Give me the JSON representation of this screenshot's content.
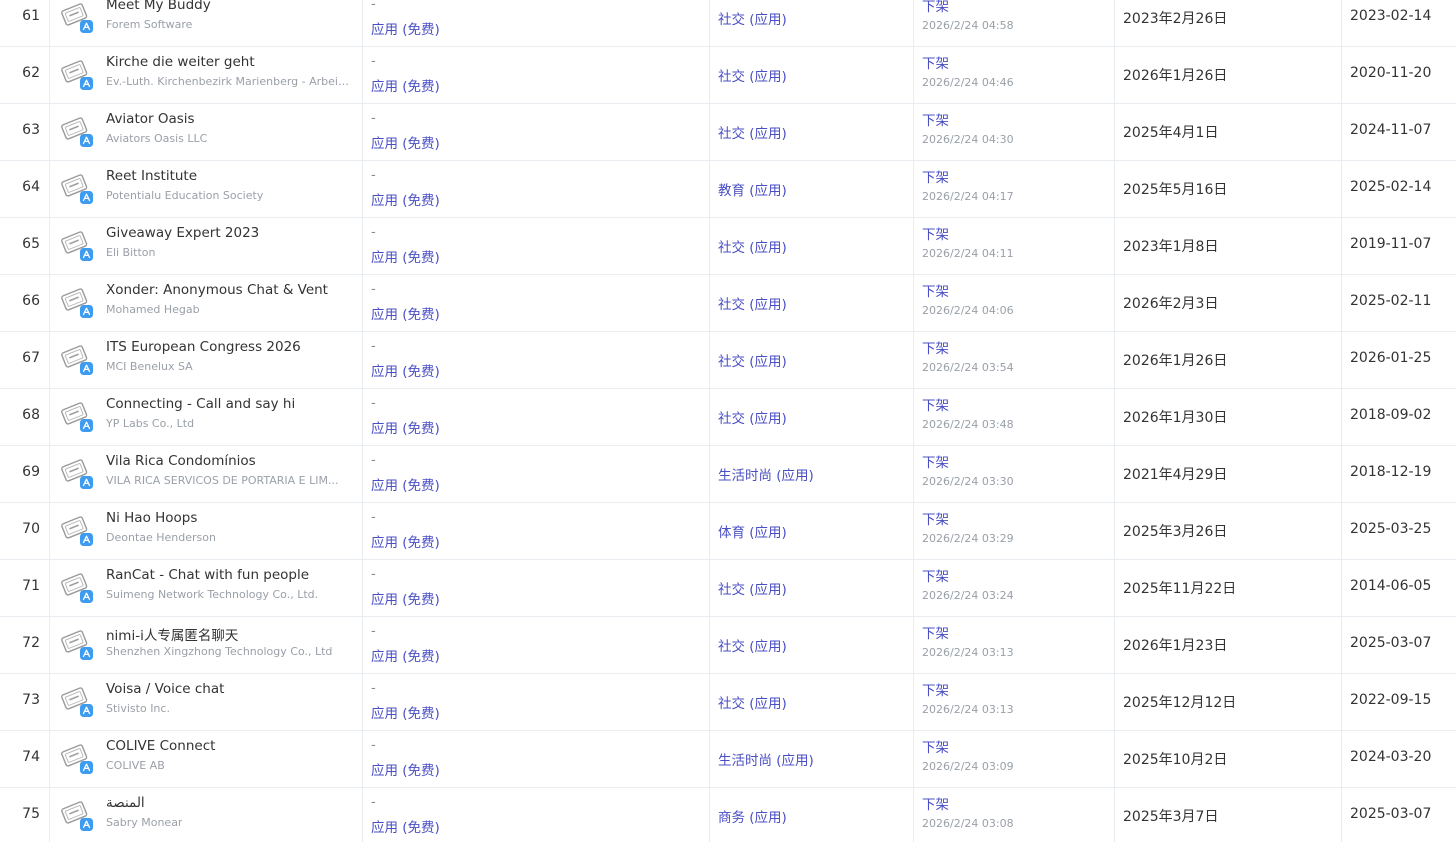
{
  "rows": [
    {
      "index": "61",
      "name": "Meet My Buddy",
      "developer": "Forem Software",
      "price_dash": "-",
      "price": "应用 (免费)",
      "category": "社交 (应用)",
      "status": "下架",
      "status_time": "2026/2/24 04:58",
      "updated": "2023年2月26日",
      "released": "2023-02-14"
    },
    {
      "index": "62",
      "name": "Kirche die weiter geht",
      "developer": "Ev.-Luth. Kirchenbezirk Marienberg - Arbeits...",
      "price_dash": "-",
      "price": "应用 (免费)",
      "category": "社交 (应用)",
      "status": "下架",
      "status_time": "2026/2/24 04:46",
      "updated": "2026年1月26日",
      "released": "2020-11-20"
    },
    {
      "index": "63",
      "name": "Aviator Oasis",
      "developer": "Aviators Oasis LLC",
      "price_dash": "-",
      "price": "应用 (免费)",
      "category": "社交 (应用)",
      "status": "下架",
      "status_time": "2026/2/24 04:30",
      "updated": "2025年4月1日",
      "released": "2024-11-07"
    },
    {
      "index": "64",
      "name": "Reet Institute",
      "developer": "Potentialu Education Society",
      "price_dash": "-",
      "price": "应用 (免费)",
      "category": "教育 (应用)",
      "status": "下架",
      "status_time": "2026/2/24 04:17",
      "updated": "2025年5月16日",
      "released": "2025-02-14"
    },
    {
      "index": "65",
      "name": "Giveaway Expert 2023",
      "developer": "Eli Bitton",
      "price_dash": "-",
      "price": "应用 (免费)",
      "category": "社交 (应用)",
      "status": "下架",
      "status_time": "2026/2/24 04:11",
      "updated": "2023年1月8日",
      "released": "2019-11-07"
    },
    {
      "index": "66",
      "name": "Xonder: Anonymous Chat & Vent",
      "developer": "Mohamed Hegab",
      "price_dash": "-",
      "price": "应用 (免费)",
      "category": "社交 (应用)",
      "status": "下架",
      "status_time": "2026/2/24 04:06",
      "updated": "2026年2月3日",
      "released": "2025-02-11"
    },
    {
      "index": "67",
      "name": "ITS European Congress 2026",
      "developer": "MCI Benelux SA",
      "price_dash": "-",
      "price": "应用 (免费)",
      "category": "社交 (应用)",
      "status": "下架",
      "status_time": "2026/2/24 03:54",
      "updated": "2026年1月26日",
      "released": "2026-01-25"
    },
    {
      "index": "68",
      "name": "Connecting - Call and say hi",
      "developer": "YP Labs Co., Ltd",
      "price_dash": "-",
      "price": "应用 (免费)",
      "category": "社交 (应用)",
      "status": "下架",
      "status_time": "2026/2/24 03:48",
      "updated": "2026年1月30日",
      "released": "2018-09-02"
    },
    {
      "index": "69",
      "name": "Vila Rica Condomínios",
      "developer": "VILA RICA SERVICOS DE PORTARIA E LIM...",
      "price_dash": "-",
      "price": "应用 (免费)",
      "category": "生活时尚 (应用)",
      "status": "下架",
      "status_time": "2026/2/24 03:30",
      "updated": "2021年4月29日",
      "released": "2018-12-19"
    },
    {
      "index": "70",
      "name": "Ni Hao Hoops",
      "developer": "Deontae Henderson",
      "price_dash": "-",
      "price": "应用 (免费)",
      "category": "体育 (应用)",
      "status": "下架",
      "status_time": "2026/2/24 03:29",
      "updated": "2025年3月26日",
      "released": "2025-03-25"
    },
    {
      "index": "71",
      "name": "RanCat - Chat with fun people",
      "developer": "Suimeng Network Technology Co., Ltd.",
      "price_dash": "-",
      "price": "应用 (免费)",
      "category": "社交 (应用)",
      "status": "下架",
      "status_time": "2026/2/24 03:24",
      "updated": "2025年11月22日",
      "released": "2014-06-05"
    },
    {
      "index": "72",
      "name": "nimi-i人专属匿名聊天",
      "developer": "Shenzhen Xingzhong Technology Co., Ltd",
      "price_dash": "-",
      "price": "应用 (免费)",
      "category": "社交 (应用)",
      "status": "下架",
      "status_time": "2026/2/24 03:13",
      "updated": "2026年1月23日",
      "released": "2025-03-07"
    },
    {
      "index": "73",
      "name": "Voisa / Voice chat",
      "developer": "Stivisto Inc.",
      "price_dash": "-",
      "price": "应用 (免费)",
      "category": "社交 (应用)",
      "status": "下架",
      "status_time": "2026/2/24 03:13",
      "updated": "2025年12月12日",
      "released": "2022-09-15"
    },
    {
      "index": "74",
      "name": "COLIVE Connect",
      "developer": "COLIVE AB",
      "price_dash": "-",
      "price": "应用 (免费)",
      "category": "生活时尚 (应用)",
      "status": "下架",
      "status_time": "2026/2/24 03:09",
      "updated": "2025年10月2日",
      "released": "2024-03-20"
    },
    {
      "index": "75",
      "name": "المنصة",
      "developer": "Sabry Monear",
      "price_dash": "-",
      "price": "应用 (免费)",
      "category": "商务 (应用)",
      "status": "下架",
      "status_time": "2026/2/24 03:08",
      "updated": "2025年3月7日",
      "released": "2025-03-07"
    }
  ],
  "icons": {
    "app_placeholder": "removed-app-stamp-icon",
    "store_badge": "app-store-badge-icon"
  },
  "colors": {
    "link": "#4a4fc4",
    "muted": "#9aa0a8",
    "text": "#333333",
    "border": "#e9ecf1",
    "badge": "#3d9bf0"
  }
}
